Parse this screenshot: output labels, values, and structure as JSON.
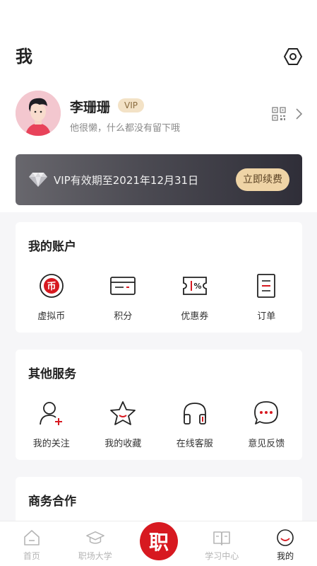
{
  "header": {
    "title": "我",
    "settings_icon": "settings-hexagon-icon"
  },
  "profile": {
    "name": "李珊珊",
    "badge": "VIP",
    "bio": "他很懒，什么都没有留下哦",
    "qr_icon": "qr-code-icon",
    "chevron_icon": "chevron-right-icon"
  },
  "vip_card": {
    "text": "VIP有效期至2021年12月31日",
    "button": "立即续费",
    "icon": "diamond-icon"
  },
  "account": {
    "title": "我的账户",
    "items": [
      {
        "label": "虚拟币",
        "icon": "coin-icon"
      },
      {
        "label": "积分",
        "icon": "card-icon"
      },
      {
        "label": "优惠券",
        "icon": "coupon-icon"
      },
      {
        "label": "订单",
        "icon": "order-icon"
      }
    ]
  },
  "services": {
    "title": "其他服务",
    "items": [
      {
        "label": "我的关注",
        "icon": "user-add-icon"
      },
      {
        "label": "我的收藏",
        "icon": "star-icon"
      },
      {
        "label": "在线客服",
        "icon": "headphones-icon"
      },
      {
        "label": "意见反馈",
        "icon": "chat-bubble-icon"
      }
    ]
  },
  "business": {
    "title": "商务合作"
  },
  "tabbar": {
    "items": [
      {
        "label": "首页",
        "icon": "home-icon"
      },
      {
        "label": "职场大学",
        "icon": "graduation-cap-icon"
      },
      {
        "label": "学习中心",
        "icon": "book-icon"
      },
      {
        "label": "我的",
        "icon": "smile-icon"
      }
    ],
    "center_glyph": "职",
    "accent": "#d71920"
  }
}
